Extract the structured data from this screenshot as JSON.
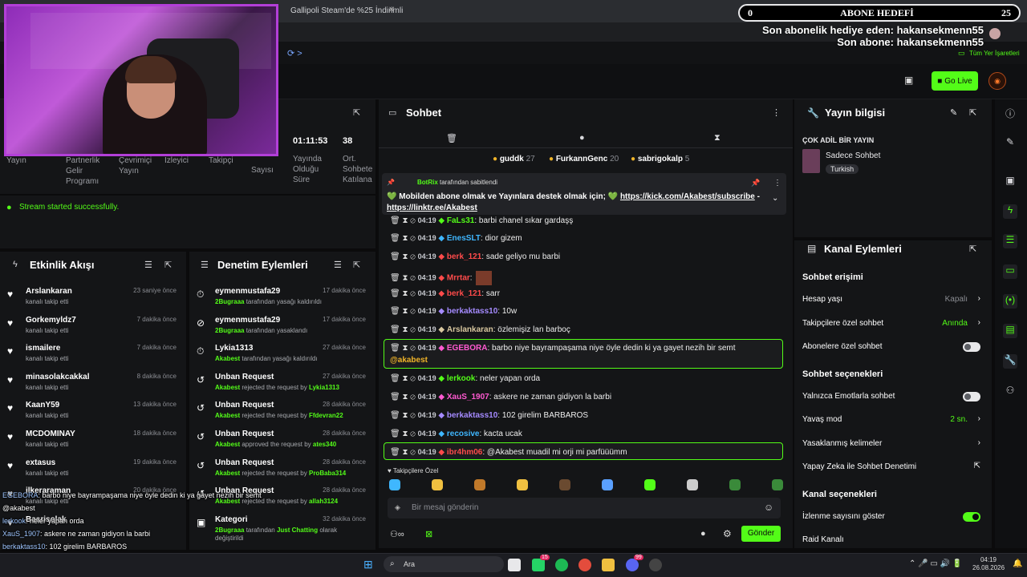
{
  "browser": {
    "tab_title": "Gallipoli Steam'de %25 İndirimli",
    "bookmarks_label": "Tüm Yer İşaretleri"
  },
  "overlay": {
    "subgoal_left": "0",
    "subgoal_title": "ABONE HEDEFİ",
    "subgoal_right": "25",
    "gift_line": "Son abonelik hediye eden: hakansekmenn55",
    "sub_line": "Son abone: hakansekmenn55"
  },
  "header": {
    "golive_label": "Go Live"
  },
  "stats": {
    "duration_value": "01:11:53",
    "duration_label": "Yayında Olduğu Süre",
    "avg_value": "38",
    "avg_label": "Ort. Sohbete Katılana",
    "labels": [
      "Yayın",
      "Partnerlik Gelir Programı",
      "Çevrimiçi Yayın",
      "İzleyici",
      "Takipçi",
      "Sayısı"
    ]
  },
  "toast": {
    "text": "Stream started successfully."
  },
  "activity": {
    "title": "Etkinlik Akışı",
    "items": [
      {
        "name": "Arslankaran",
        "sub": "kanalı takip etti",
        "time": "23 saniye önce"
      },
      {
        "name": "Gorkemyldz7",
        "sub": "kanalı takip etti",
        "time": "7 dakika önce"
      },
      {
        "name": "ismailere",
        "sub": "kanalı takip etti",
        "time": "7 dakika önce"
      },
      {
        "name": "minasolakcakkal",
        "sub": "kanalı takip etti",
        "time": "8 dakika önce"
      },
      {
        "name": "KaanY59",
        "sub": "kanalı takip etti",
        "time": "13 dakika önce"
      },
      {
        "name": "MCDOMINAY",
        "sub": "kanalı takip etti",
        "time": "18 dakika önce"
      },
      {
        "name": "extasus",
        "sub": "kanalı takip etti",
        "time": "19 dakika önce"
      },
      {
        "name": "ilkeraraman",
        "sub": "kanalı takip etti",
        "time": "20 dakika önce"
      },
      {
        "name": "Basrisolak",
        "sub": "",
        "time": ""
      }
    ]
  },
  "moderation": {
    "title": "Denetim Eylemleri",
    "items": [
      {
        "name": "eymenmustafa29",
        "actor": "2Bugraaa",
        "sub": "tarafından yasağı kaldırıldı",
        "time": "17 dakika önce",
        "icon": "⏱"
      },
      {
        "name": "eymenmustafa29",
        "actor": "2Bugraaa",
        "sub": "tarafından yasaklandı",
        "time": "17 dakika önce",
        "icon": "⊘"
      },
      {
        "name": "Lykia1313",
        "actor": "Akabest",
        "sub": "tarafından yasağı kaldırıldı",
        "time": "27 dakika önce",
        "icon": "⏱"
      },
      {
        "name": "Unban Request",
        "actor": "Akabest",
        "sub": "rejected the request by",
        "target": "Lykia1313",
        "time": "27 dakika önce",
        "icon": "↺"
      },
      {
        "name": "Unban Request",
        "actor": "Akabest",
        "sub": "rejected the request by",
        "target": "Ffdevran22",
        "time": "28 dakika önce",
        "icon": "↺"
      },
      {
        "name": "Unban Request",
        "actor": "Akabest",
        "sub": "approved the request by",
        "target": "ates340",
        "time": "28 dakika önce",
        "icon": "↺"
      },
      {
        "name": "Unban Request",
        "actor": "Akabest",
        "sub": "rejected the request by",
        "target": "ProBaba314",
        "time": "28 dakika önce",
        "icon": "↺"
      },
      {
        "name": "Unban Request",
        "actor": "Akabest",
        "sub": "rejected the request by",
        "target": "allah3124",
        "time": "28 dakika önce",
        "icon": "↺"
      },
      {
        "name": "Kategori",
        "actor": "2Bugraaa",
        "sub": "tarafından",
        "target": "Just Chatting",
        "sub2": "olarak değiştirildi",
        "time": "32 dakika önce",
        "icon": "▣"
      }
    ]
  },
  "chat": {
    "title": "Sohbet",
    "gifters": [
      {
        "name": "guddk",
        "count": "27"
      },
      {
        "name": "FurkannGenc",
        "count": "20"
      },
      {
        "name": "sabrigokalp",
        "count": "5"
      }
    ],
    "pinned": {
      "by": "BotRix",
      "by_suffix": "tarafından sabitlendi",
      "text": "💚 Mobilden abone olmak ve Yayınlara destek olmak için; 💚",
      "link1": "https://kick.com/Akabest/subscribe",
      "dash": "-",
      "link2": "https://linktr.ee/Akabest"
    },
    "messages": [
      {
        "time": "04:19",
        "user": "FaLs31",
        "color": "#53fc18",
        "text": "barbi chanel sıkar gardaşş"
      },
      {
        "time": "04:19",
        "user": "EnesSLT",
        "color": "#3fb7ff",
        "text": "dior gizem"
      },
      {
        "time": "04:19",
        "user": "berk_121",
        "color": "#ff4b4b",
        "text": "sade geliyo mu barbi"
      },
      {
        "time": "04:19",
        "user": "Mrrtar",
        "color": "#ff4b4b",
        "text": ""
      },
      {
        "time": "04:19",
        "user": "berk_121",
        "color": "#ff4b4b",
        "text": "sarr"
      },
      {
        "time": "04:19",
        "user": "berkaktass10",
        "color": "#a58bff",
        "text": "10w"
      },
      {
        "time": "04:19",
        "user": "Arslankaran",
        "color": "#d9c8a0",
        "text": "özlemişiz lan barboç"
      },
      {
        "time": "04:19",
        "user": "EGEBORA",
        "color": "#ff5ad1",
        "text": "barbo niye bayrampaşama niye öyle dedin ki ya gayet nezih bir semt",
        "mention": "@akabest"
      },
      {
        "time": "04:19",
        "user": "lerkook",
        "color": "#53fc18",
        "text": "neler yapan orda"
      },
      {
        "time": "04:19",
        "user": "XauS_1907",
        "color": "#ff5ad1",
        "text": "askere ne zaman gidiyon la barbi"
      },
      {
        "time": "04:19",
        "user": "berkaktass10",
        "color": "#a58bff",
        "text": "102 girelim BARBAROS"
      },
      {
        "time": "04:19",
        "user": "recosive",
        "color": "#3fb7ff",
        "text": "kacta ucak"
      },
      {
        "time": "04:19",
        "user": "ibr4hm06",
        "color": "#ff4b4b",
        "text": "@Akabest muadil mi orji mi parfüüümm"
      }
    ],
    "followers_only_label": "Takipçilere Özel",
    "input_placeholder": "Bir mesaj gönderin",
    "send_label": "Gönder"
  },
  "stream_info": {
    "title": "Yayın bilgisi",
    "stream_title": "ÇOK ADİL BİR YAYIN",
    "category": "Sadece Sohbet",
    "tag": "Turkish"
  },
  "channel_actions": {
    "title": "Kanal Eylemleri",
    "chat_access": "Sohbet erişimi",
    "account_age": "Hesap yaşı",
    "account_age_value": "Kapalı",
    "followers_only": "Takipçilere özel sohbet",
    "followers_only_value": "Anında",
    "subs_only": "Abonelere özel sohbet",
    "chat_options": "Sohbet seçenekleri",
    "emote_only": "Yalnızca Emotlarla sohbet",
    "slow_mode": "Yavaş mod",
    "slow_mode_value": "2 sn.",
    "banned_words": "Yasaklanmış kelimeler",
    "ai_mod": "Yapay Zeka ile Sohbet Denetimi",
    "channel_options": "Kanal seçenekleri",
    "show_viewers": "İzlenme sayısını göster",
    "raid": "Raid Kanalı"
  },
  "overlay_chat": [
    {
      "user": "EGEBORA",
      "text": ": barbo niye bayrampaşama niye öyle dedin ki ya gayet nezih bir semt"
    },
    {
      "user": "",
      "text": "@akabest"
    },
    {
      "user": "lerkook",
      "text": ": neler yapan orda"
    },
    {
      "user": "XauS_1907",
      "text": ": askere ne zaman gidiyon la barbi"
    },
    {
      "user": "berkaktass10",
      "text": ": 102 girelim BARBAROS"
    },
    {
      "user": "recosive",
      "text": ": kacta ucak"
    },
    {
      "user": "ibr4hm06",
      "text": ": @Akabest muadil mi orji mi parfüüümm"
    }
  ],
  "taskbar": {
    "search_label": "Ara",
    "time": "04:19",
    "date": "26.08.2026",
    "badge1": "15",
    "badge2": "99"
  }
}
